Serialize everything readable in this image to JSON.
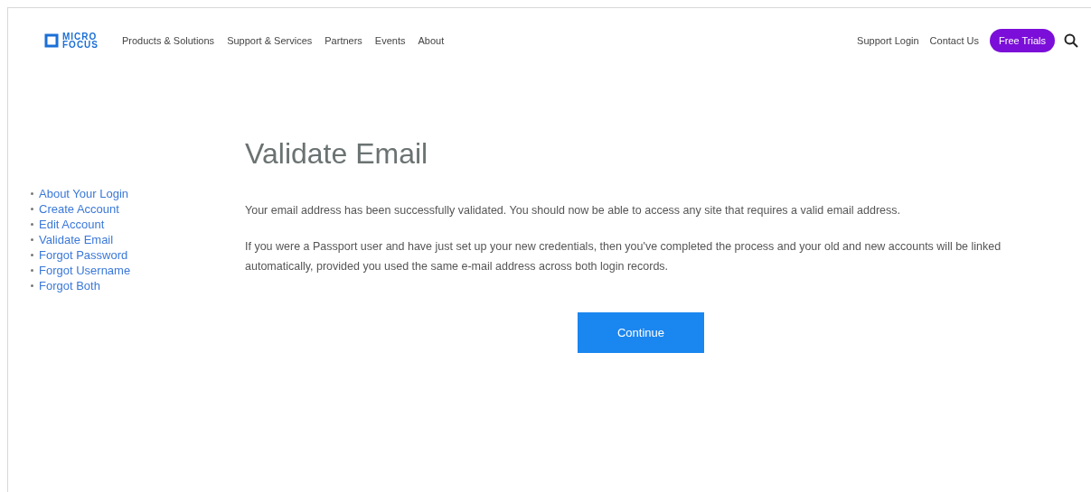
{
  "logo": {
    "line_1": "MICRO",
    "line_2": "FOCUS"
  },
  "nav": [
    "Products & Solutions",
    "Support & Services",
    "Partners",
    "Events",
    "About"
  ],
  "utility_links": [
    "Support Login",
    "Contact Us"
  ],
  "cta": "Free Trials",
  "sidebar": {
    "items": [
      {
        "label": "About Your Login"
      },
      {
        "label": "Create Account"
      },
      {
        "label": "Edit Account"
      },
      {
        "label": "Validate Email"
      },
      {
        "label": "Forgot Password"
      },
      {
        "label": "Forgot Username"
      },
      {
        "label": "Forgot Both"
      }
    ]
  },
  "title": "Validate Email",
  "paragraphs": [
    "Your email address has been successfully validated. You should now be able to access any site that requires a valid email address.",
    "If you were a Passport user and have just set up your new credentials, then you've completed the process and your old and new accounts will be linked automatically, provided you used the same e-mail address across both login records."
  ],
  "button": "Continue"
}
